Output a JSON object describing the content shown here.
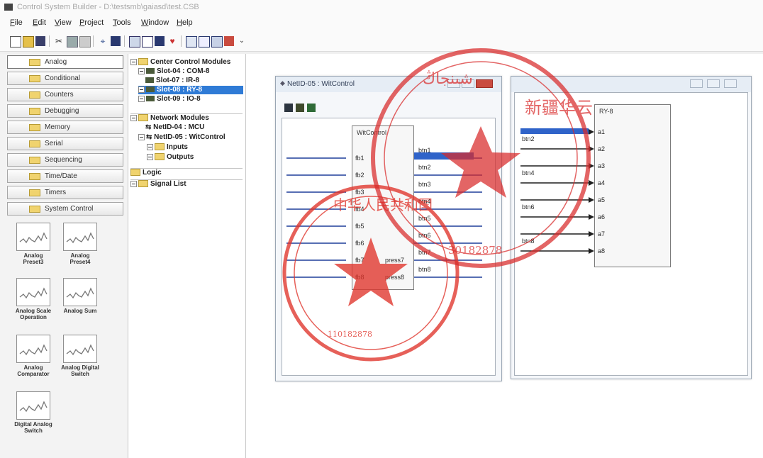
{
  "app": {
    "title": "Control System Builder - D:\\testsmb\\gaiasd\\test.CSB"
  },
  "menu": [
    "File",
    "Edit",
    "View",
    "Project",
    "Tools",
    "Window",
    "Help"
  ],
  "categories": [
    {
      "label": "Analog",
      "selected": true
    },
    {
      "label": "Conditional",
      "selected": false
    },
    {
      "label": "Counters",
      "selected": false
    },
    {
      "label": "Debugging",
      "selected": false
    },
    {
      "label": "Memory",
      "selected": false
    },
    {
      "label": "Serial",
      "selected": false
    },
    {
      "label": "Sequencing",
      "selected": false
    },
    {
      "label": "Time/Date",
      "selected": false
    },
    {
      "label": "Timers",
      "selected": false
    },
    {
      "label": "System Control",
      "selected": false
    }
  ],
  "blocks": [
    {
      "label": "Analog Preset3"
    },
    {
      "label": "Analog Preset4"
    },
    {
      "label": "Analog Scale Operation"
    },
    {
      "label": "Analog Sum"
    },
    {
      "label": "Analog Comparator"
    },
    {
      "label": "Analog Digital Switch"
    },
    {
      "label": "Digital Analog Switch"
    }
  ],
  "tree": {
    "center_control": "Center Control Modules",
    "slot04": "Slot-04 : COM-8",
    "slot07": "Slot-07 : IR-8",
    "slot08": "Slot-08 : RY-8",
    "slot09": "Slot-09 : IO-8",
    "network": "Network Modules",
    "netid04": "NetID-04 : MCU",
    "netid05": "NetID-05 : WitControl",
    "inputs": "Inputs",
    "outputs": "Outputs",
    "logic": "Logic",
    "signal_list": "Signal List"
  },
  "window1": {
    "title": "NetID-05 : WitControl",
    "module_title": "WitControl",
    "inputs": [
      "fb1",
      "fb2",
      "fb3",
      "fb4",
      "fb5",
      "fb6",
      "fb7",
      "fb8"
    ],
    "outputs": [
      "btn1",
      "btn2",
      "btn3",
      "btn4",
      "btn5",
      "btn6",
      "btn7",
      "btn8"
    ],
    "presses": [
      "press7",
      "press8"
    ]
  },
  "window2": {
    "module_title": "RY-8",
    "wires": [
      "btn2",
      "btn4",
      "btn6",
      "btn8"
    ],
    "pins": [
      "a1",
      "a2",
      "a3",
      "a4",
      "a5",
      "a6",
      "a7",
      "a8"
    ]
  },
  "stamps": {
    "red_round_inner": "中华人民共和国",
    "red_round_number": "110182878",
    "big_round_uyghur": "شىنجاڭ",
    "big_round_chinese": "新疆华云",
    "big_round_number": "30182878"
  },
  "colors": {
    "selection": "#2f7bd6",
    "stamp_red": "#e0342b",
    "wire_blue": "#1f3f9a"
  }
}
